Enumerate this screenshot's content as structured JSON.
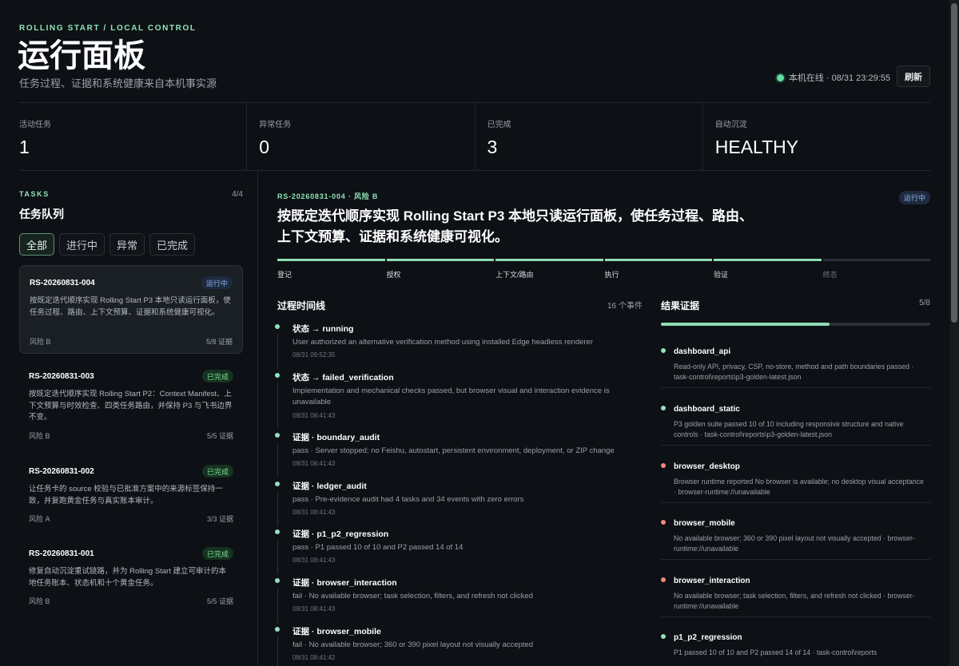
{
  "header": {
    "eyebrow": "ROLLING START / LOCAL CONTROL",
    "title": "运行面板",
    "subtitle": "任务过程、证据和系统健康来自本机事实源",
    "status_text": "本机在线 · 08/31 23:29:55",
    "refresh_label": "刷新"
  },
  "stats": [
    {
      "label": "活动任务",
      "value": "1"
    },
    {
      "label": "异常任务",
      "value": "0"
    },
    {
      "label": "已完成",
      "value": "3"
    },
    {
      "label": "自动沉淀",
      "value": "HEALTHY"
    }
  ],
  "tasks": {
    "eyebrow": "TASKS",
    "count": "4/4",
    "title": "任务队列",
    "filters": [
      "全部",
      "进行中",
      "异常",
      "已完成"
    ],
    "items": [
      {
        "id": "RS-20260831-004",
        "badge": "运行中",
        "desc": "按既定迭代顺序实现 Rolling Start P3 本地只读运行面板，使任务过程、路由、上下文预算、证据和系统健康可视化。",
        "risk": "风险 B",
        "evidence": "5/8 证据"
      },
      {
        "id": "RS-20260831-003",
        "badge": "已完成",
        "desc": "按既定迭代顺序实现 Rolling Start P2：Context Manifest、上下文预算与时效检查、四类任务路由，并保持 P3 与飞书边界不变。",
        "risk": "风险 B",
        "evidence": "5/5 证据"
      },
      {
        "id": "RS-20260831-002",
        "badge": "已完成",
        "desc": "让任务卡的 source 校验与已批准方案中的来源标签保持一致，并复跑黄金任务与真实账本审计。",
        "risk": "风险 A",
        "evidence": "3/3 证据"
      },
      {
        "id": "RS-20260831-001",
        "badge": "已完成",
        "desc": "修复自动沉淀重试链路，并为 Rolling Start 建立可审计的本地任务账本、状态机和十个黄金任务。",
        "risk": "风险 B",
        "evidence": "5/5 证据"
      }
    ]
  },
  "detail": {
    "eyebrow": "RS-20260831-004 · 风险 B",
    "badge": "运行中",
    "title": "按既定迭代顺序实现 Rolling Start P3 本地只读运行面板，使任务过程、路由、上下文预算、证据和系统健康可视化。",
    "stages": [
      {
        "label": "登记",
        "done": true
      },
      {
        "label": "授权",
        "done": true
      },
      {
        "label": "上下文/路由",
        "done": true
      },
      {
        "label": "执行",
        "done": true
      },
      {
        "label": "验证",
        "done": true
      },
      {
        "label": "终态",
        "done": false
      }
    ],
    "timeline": {
      "title": "过程时间线",
      "count": "16 个事件",
      "events": [
        {
          "title": "状态 → running",
          "desc": "User authorized an alternative verification method using installed Edge headless renderer",
          "time": "08/31 09:52:35"
        },
        {
          "title": "状态 → failed_verification",
          "desc": "Implementation and mechanical checks passed, but browser visual and interaction evidence is unavailable",
          "time": "08/31 08:41:43"
        },
        {
          "title": "证据 · boundary_audit",
          "desc": "pass · Server stopped; no Feishu, autostart, persistent environment, deployment, or ZIP change",
          "time": "08/31 08:41:43"
        },
        {
          "title": "证据 · ledger_audit",
          "desc": "pass · Pre-evidence audit had 4 tasks and 34 events with zero errors",
          "time": "08/31 08:41:43"
        },
        {
          "title": "证据 · p1_p2_regression",
          "desc": "pass · P1 passed 10 of 10 and P2 passed 14 of 14",
          "time": "08/31 08:41:43"
        },
        {
          "title": "证据 · browser_interaction",
          "desc": "fail · No available browser; task selection, filters, and refresh not clicked",
          "time": "08/31 08:41:43"
        },
        {
          "title": "证据 · browser_mobile",
          "desc": "fail · No available browser; 360 or 390 pixel layout not visually accepted",
          "time": "08/31 08:41:42"
        }
      ]
    },
    "evidence": {
      "title": "结果证据",
      "count": "5/8",
      "progress": 0.625,
      "items": [
        {
          "name": "dashboard_api",
          "status": "pass",
          "desc": "Read-only API, privacy, CSP, no-store, method and path boundaries passed · task-control\\reports\\p3-golden-latest.json"
        },
        {
          "name": "dashboard_static",
          "status": "pass",
          "desc": "P3 golden suite passed 10 of 10 including responsive structure and native controls · task-control\\reports\\p3-golden-latest.json"
        },
        {
          "name": "browser_desktop",
          "status": "fail",
          "desc": "Browser runtime reported No browser is available; no desktop visual acceptance · browser-runtime://unavailable"
        },
        {
          "name": "browser_mobile",
          "status": "fail",
          "desc": "No available browser; 360 or 390 pixel layout not visually accepted · browser-runtime://unavailable"
        },
        {
          "name": "browser_interaction",
          "status": "fail",
          "desc": "No available browser; task selection, filters, and refresh not clicked · browser-runtime://unavailable"
        },
        {
          "name": "p1_p2_regression",
          "status": "pass",
          "desc": "P1 passed 10 of 10 and P2 passed 14 of 14 · task-control\\reports"
        }
      ]
    }
  }
}
